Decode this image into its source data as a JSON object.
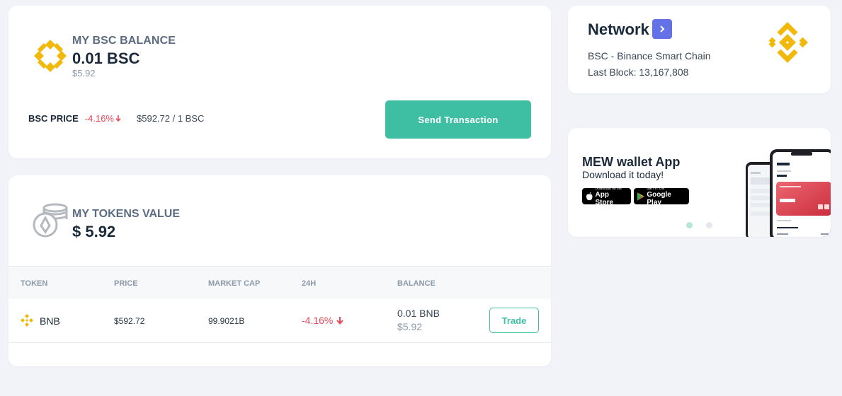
{
  "balance": {
    "title": "MY BSC BALANCE",
    "amount": "0.01 BSC",
    "usd": "$5.92",
    "price_label": "BSC PRICE",
    "price_change": "-4.16%",
    "price_value": "$592.72 / 1 BSC",
    "send_label": "Send Transaction"
  },
  "tokens": {
    "title": "MY TOKENS VALUE",
    "value": "$ 5.92",
    "columns": [
      "TOKEN",
      "PRICE",
      "MARKET CAP",
      "24H",
      "BALANCE"
    ],
    "rows": [
      {
        "name": "BNB",
        "price": "$592.72",
        "market_cap": "99.9021B",
        "change_24h": "-4.16%",
        "balance": "0.01 BNB",
        "balance_usd": "$5.92",
        "action": "Trade"
      }
    ]
  },
  "network": {
    "title": "Network",
    "chain": "BSC - Binance Smart Chain",
    "last_block": "Last Block: 13,167,808"
  },
  "mew": {
    "title": "MEW wallet App",
    "subtitle": "Download it today!",
    "appstore_small": "Download on the",
    "appstore_big": "App Store",
    "googleplay_small": "GET IT ON",
    "googleplay_big": "Google Play"
  },
  "colors": {
    "accent": "#3ebfa4",
    "negative": "#e8485a",
    "bnb": "#f0b90b",
    "network_button": "#6472e8"
  },
  "icons": [
    "bnb-logo-icon",
    "arrow-down-icon",
    "coins-stack-icon",
    "chevron-right-icon",
    "apple-icon",
    "google-play-icon"
  ]
}
